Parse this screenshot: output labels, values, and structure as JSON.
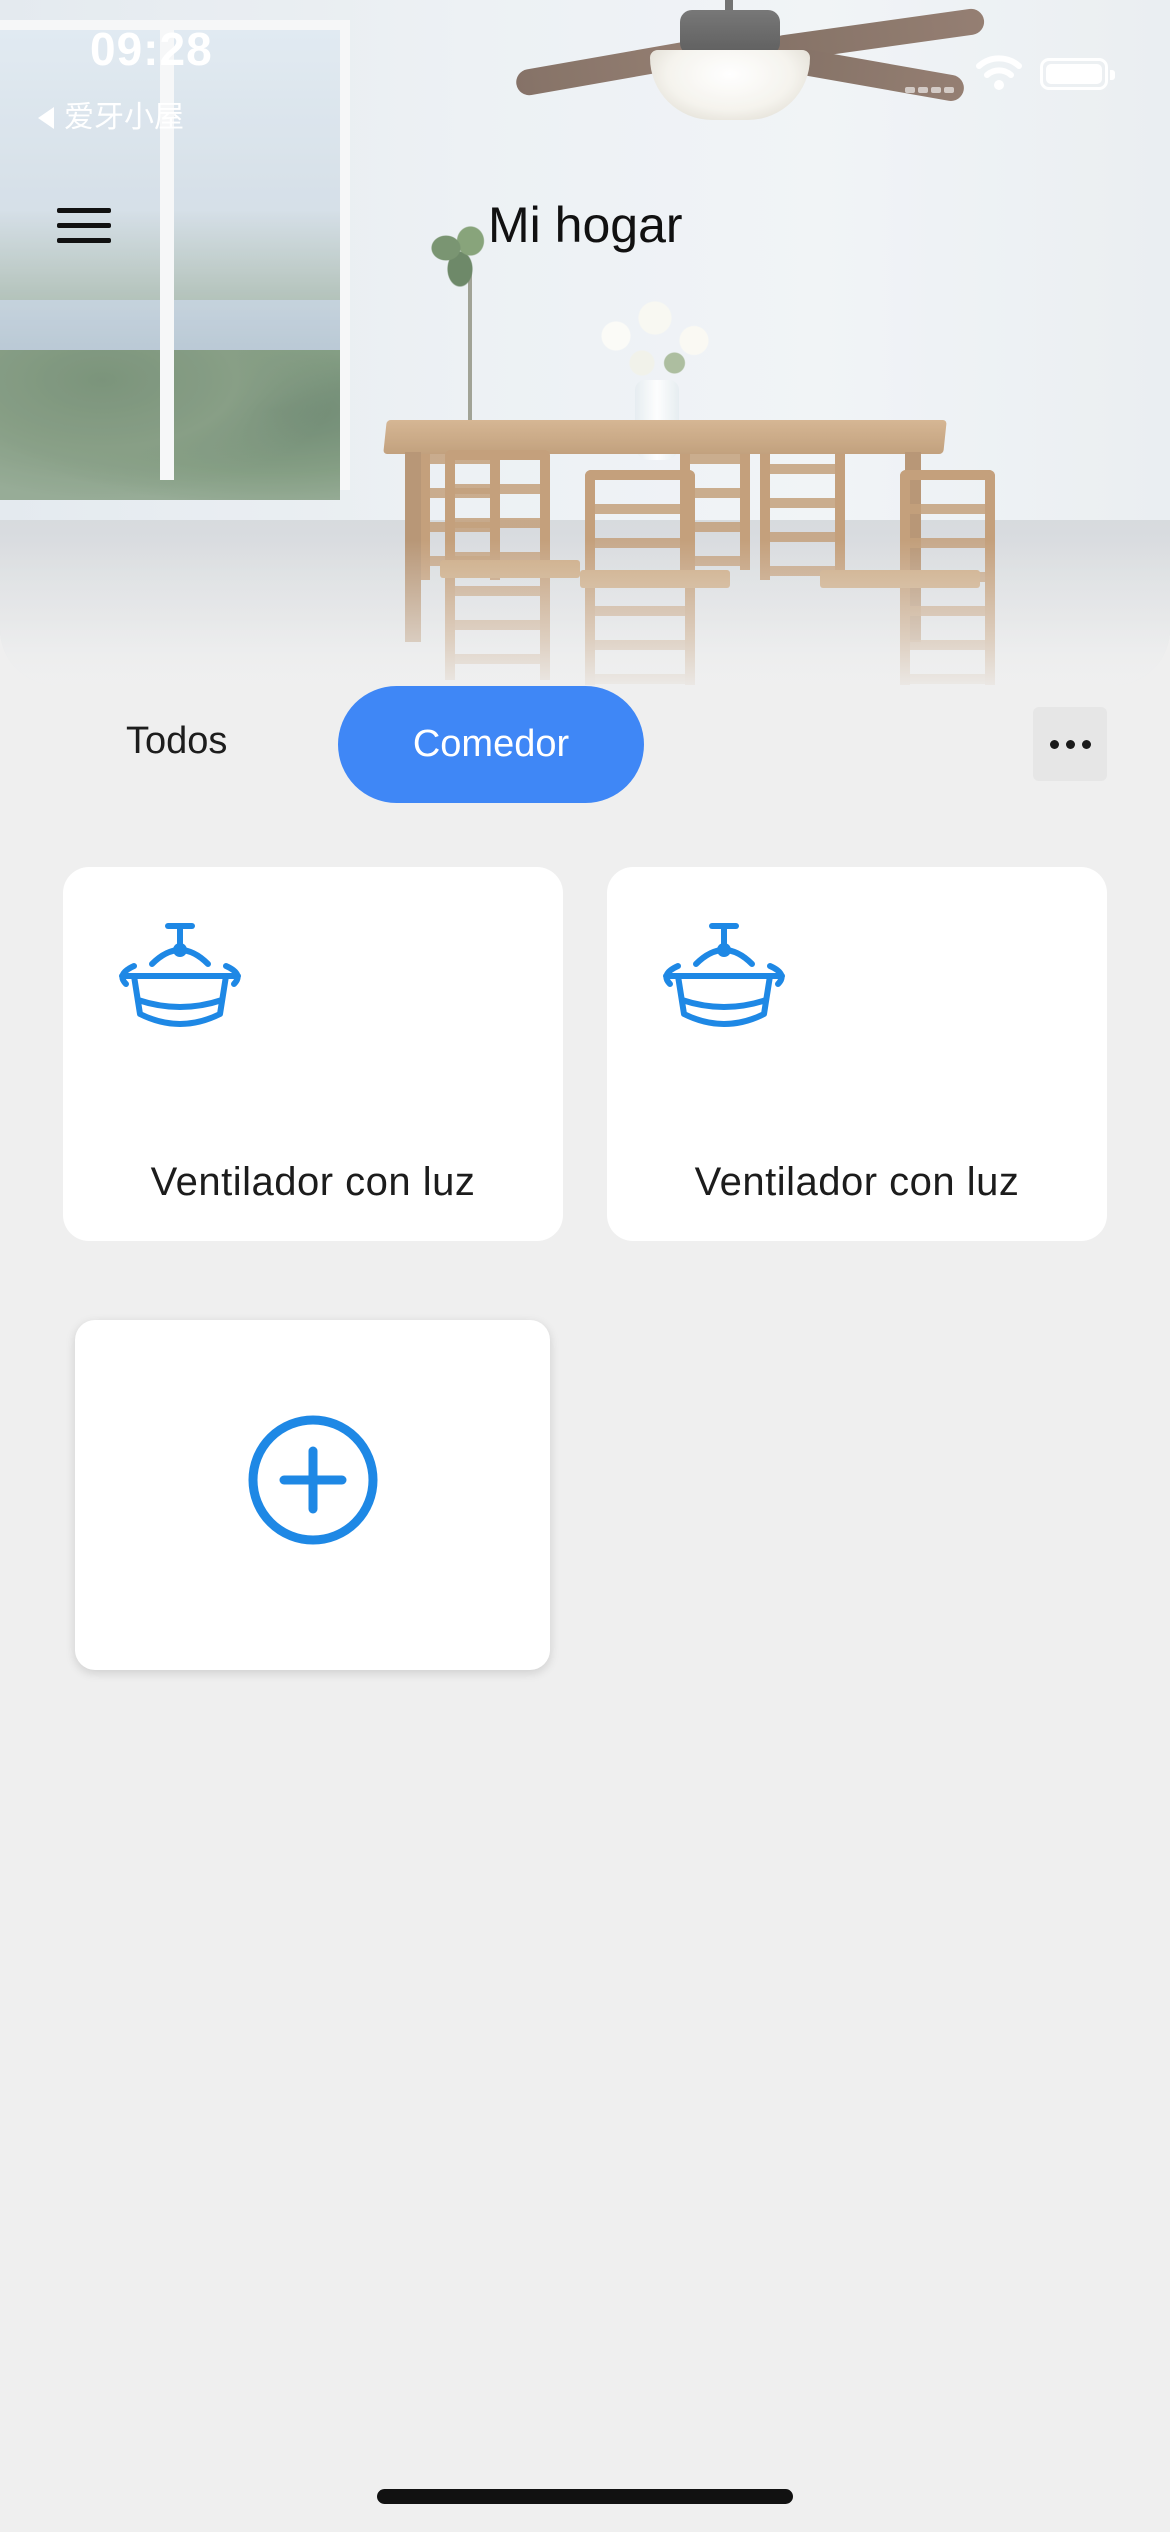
{
  "status_bar": {
    "time": "09:28",
    "back_app": "爱牙小屋"
  },
  "header": {
    "title": "Mi hogar",
    "menu_icon": "hamburger-menu-icon",
    "background": "dining-room-photo"
  },
  "tabs": [
    {
      "label": "Todos",
      "active": false
    },
    {
      "label": "Comedor",
      "active": true
    }
  ],
  "more_icon": "more-horizontal-icon",
  "devices": [
    {
      "name": "Ventilador con luz",
      "icon": "ceiling-fan-light-icon"
    },
    {
      "name": "Ventilador con luz",
      "icon": "ceiling-fan-light-icon"
    }
  ],
  "add_device_icon": "add-circle-icon",
  "colors": {
    "accent": "#3f87f6",
    "icon_blue": "#1e88e5",
    "background": "#efefef",
    "card": "#ffffff"
  }
}
